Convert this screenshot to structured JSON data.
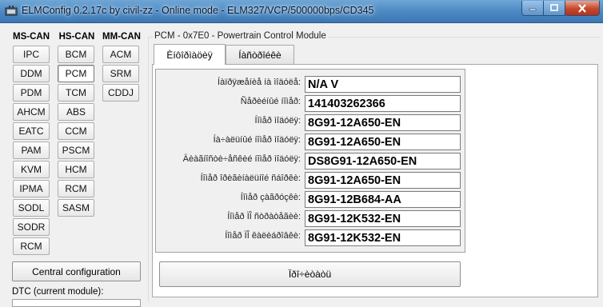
{
  "window": {
    "title": "ELMConfig 0.2.17c by civil-zz - Online mode - ELM327/VCP/500000bps/CD345"
  },
  "columns": {
    "ms_can": {
      "header": "MS-CAN",
      "buttons": [
        "IPC",
        "DDM",
        "PDM",
        "AHCM",
        "EATC",
        "PAM",
        "KVM",
        "IPMA",
        "SODL",
        "SODR",
        "RCM"
      ]
    },
    "hs_can": {
      "header": "HS-CAN",
      "buttons": [
        "BCM",
        "PCM",
        "TCM",
        "ABS",
        "CCM",
        "PSCM",
        "HCM",
        "RCM",
        "SASM"
      ],
      "active": "PCM"
    },
    "mm_can": {
      "header": "MM-CAN",
      "buttons": [
        "ACM",
        "SRM",
        "CDDJ"
      ]
    }
  },
  "central_config_label": "Central configuration",
  "dtc_label": "DTC (current module):",
  "module": {
    "caption": "PCM - 0x7E0 - Powertrain Control Module",
    "tabs": [
      "Èíôîðìàöèÿ",
      "Íàñòðîéêè"
    ],
    "selected_tab": 0,
    "fields": [
      {
        "label": "Íàïðÿæåíèå íà ìîäóëå:",
        "value": "N/A V"
      },
      {
        "label": "Ñåðèéíûé íîìåð:",
        "value": "141403262366"
      },
      {
        "label": "Íîìåð ìîäóëÿ:",
        "value": "8G91-12A650-EN"
      },
      {
        "label": "Íà÷àëüíûé íîìåð ìîäóëÿ:",
        "value": "8G91-12A650-EN"
      },
      {
        "label": "Äèàãíîñòè÷åñêèé íîìåð ìîäóëÿ:",
        "value": "DS8G91-12A650-EN"
      },
      {
        "label": "Íîìåð îðèãèíàëüíîé ñáîðêè:",
        "value": "8G91-12A650-EN"
      },
      {
        "label": "Íîìåð çàãðóçêè:",
        "value": "8G91-12B684-AA"
      },
      {
        "label": "Íîìåð ÏÎ ñòðàòåãèè:",
        "value": "8G91-12K532-EN"
      },
      {
        "label": "Íîìåð ÏÎ êàëèáðîâêè:",
        "value": "8G91-12K532-EN"
      }
    ],
    "read_button_label": "Ïðî÷èòàòü"
  }
}
